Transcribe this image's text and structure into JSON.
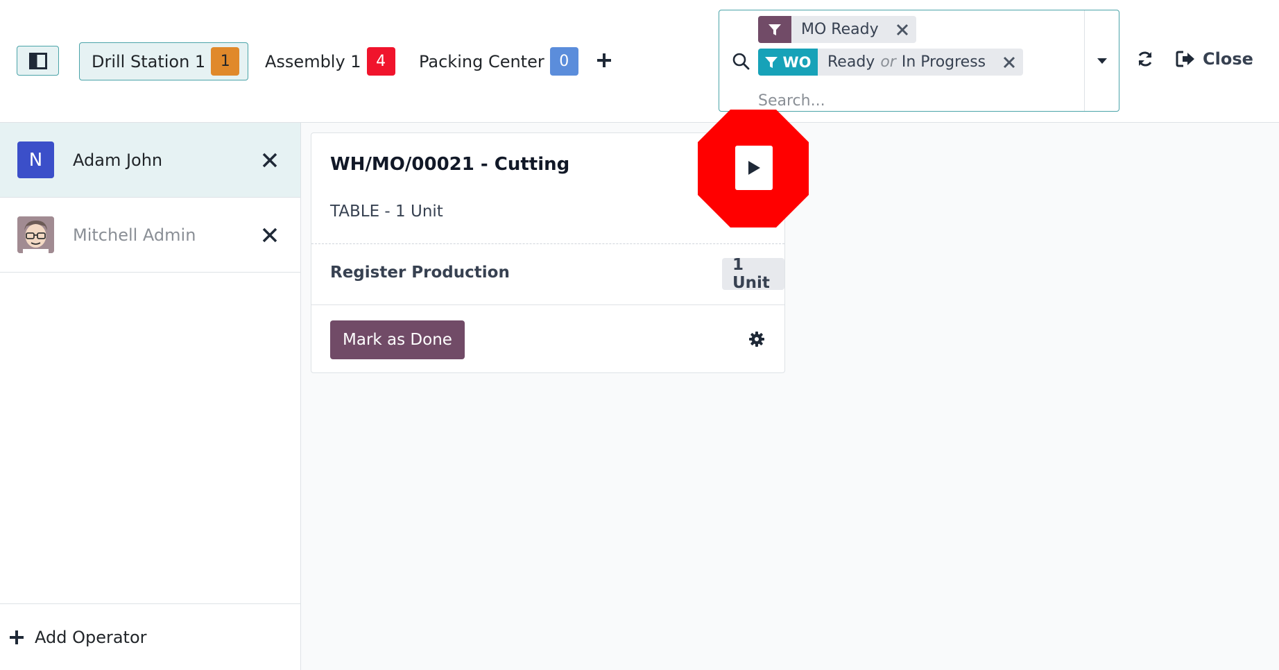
{
  "workcenters": [
    {
      "label": "Drill Station 1",
      "count": "1",
      "color": "#e0892b",
      "text_color": "#212529",
      "active": true
    },
    {
      "label": "Assembly 1",
      "count": "4",
      "color": "#f0142c",
      "text_color": "#ffffff",
      "active": false
    },
    {
      "label": "Packing Center",
      "count": "0",
      "color": "#5b8ddb",
      "text_color": "#ffffff",
      "active": false
    }
  ],
  "search": {
    "facets": [
      {
        "label_icon": "filter-icon",
        "label": "",
        "values": [
          "MO Ready"
        ],
        "color": "#714b67"
      },
      {
        "label_icon": "filter-icon",
        "label": "WO",
        "values": [
          "Ready",
          "In Progress"
        ],
        "separator": "or",
        "color": "#17a2b8"
      }
    ],
    "placeholder": "Search..."
  },
  "actions": {
    "close_label": "Close"
  },
  "operators": [
    {
      "name": "Adam John",
      "initial": "N",
      "avatar_color": "#3b4fc9",
      "active": true
    },
    {
      "name": "Mitchell Admin",
      "initial": "",
      "avatar_color": "#a18b92",
      "active": false
    }
  ],
  "sidebar": {
    "add_operator_label": "Add Operator"
  },
  "card": {
    "title": "WH/MO/00021 - Cutting",
    "subtitle": "TABLE - 1 Unit",
    "register_label": "Register Production",
    "register_qty": "1 Unit",
    "done_label": "Mark as Done"
  },
  "colors": {
    "accent": "#714b67",
    "teal": "#4aa3a8",
    "stop_red": "#ff0000"
  }
}
